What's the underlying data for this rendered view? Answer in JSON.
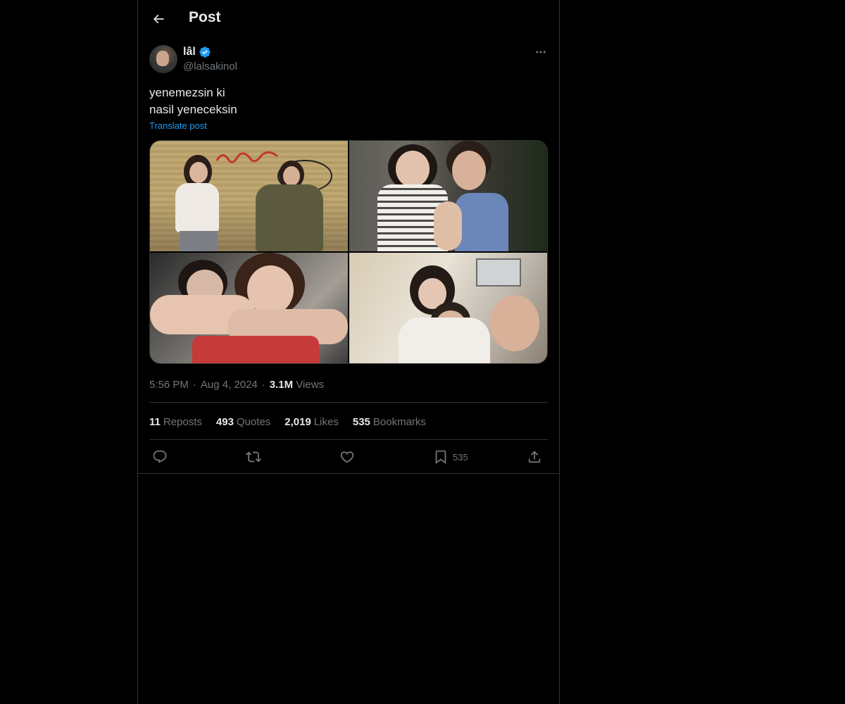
{
  "header": {
    "title": "Post",
    "back_icon": "arrow-left-icon"
  },
  "author": {
    "display_name": "lâl",
    "handle": "@lalsakinol",
    "verified": true,
    "verified_color": "#1d9bf0"
  },
  "post": {
    "lines": [
      "yenemezsin ki",
      "nasil yeneceksin"
    ],
    "translate_label": "Translate post",
    "media_count": 4
  },
  "meta": {
    "time": "5:56 PM",
    "date": "Aug 4, 2024",
    "views_count": "3.1M",
    "views_label": "Views",
    "separator": "·"
  },
  "stats": [
    {
      "count": "11",
      "label": "Reposts"
    },
    {
      "count": "493",
      "label": "Quotes"
    },
    {
      "count": "2,019",
      "label": "Likes"
    },
    {
      "count": "535",
      "label": "Bookmarks"
    }
  ],
  "actions": {
    "reply_icon": "reply-icon",
    "repost_icon": "repost-icon",
    "like_icon": "heart-icon",
    "bookmark_icon": "bookmark-icon",
    "bookmark_count": "535",
    "share_icon": "share-icon"
  },
  "colors": {
    "background": "#000000",
    "text": "#e7e9ea",
    "muted": "#71767b",
    "accent": "#1d9bf0",
    "border": "#2f3336"
  }
}
